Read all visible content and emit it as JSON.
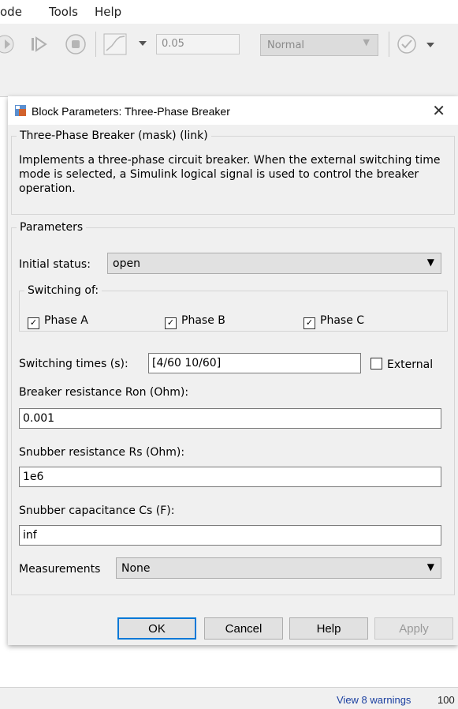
{
  "menubar": {
    "items": [
      "ode",
      "Tools",
      "Help"
    ]
  },
  "toolbar": {
    "stop_time": "0.05",
    "sim_mode": "Normal",
    "icons": [
      "step-back-icon",
      "step-forward-icon",
      "stop-icon",
      "scope-icon",
      "check-icon"
    ]
  },
  "dialog": {
    "title": "Block Parameters: Three-Phase Breaker",
    "close_glyph": "✕",
    "mask_legend": "Three-Phase Breaker (mask) (link)",
    "description": "Implements a three-phase circuit breaker. When the external switching time mode is selected, a Simulink logical signal is used to control the breaker operation.",
    "params_legend": "Parameters",
    "initial_status_label": "Initial status:",
    "initial_status_value": "open",
    "switching_legend": "Switching of:",
    "phase_a": "Phase A",
    "phase_b": "Phase B",
    "phase_c": "Phase C",
    "phase_a_checked": true,
    "phase_b_checked": true,
    "phase_c_checked": true,
    "switching_times_label": "Switching times (s):",
    "switching_times_value": "[4/60  10/60]",
    "external_label": "External",
    "external_checked": false,
    "ron_label": "Breaker resistance Ron (Ohm):",
    "ron_value": "0.001",
    "rs_label": "Snubber resistance Rs (Ohm):",
    "rs_value": "1e6",
    "cs_label": "Snubber capacitance Cs (F):",
    "cs_value": "inf",
    "measurements_label": "Measurements",
    "measurements_value": "None",
    "buttons": {
      "ok": "OK",
      "cancel": "Cancel",
      "help": "Help",
      "apply": "Apply"
    }
  },
  "statusbar": {
    "warnings": "View 8 warnings",
    "zoom": "100"
  },
  "colors": {
    "accent": "#0078d7",
    "link": "#1a3fa0",
    "dialog_bg": "#f0f0f0"
  }
}
